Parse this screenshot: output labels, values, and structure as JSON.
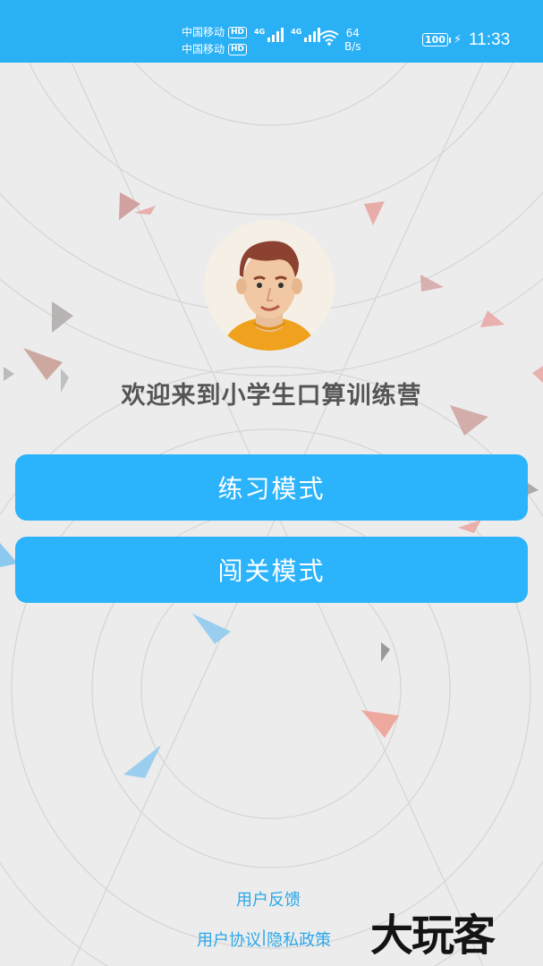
{
  "status_bar": {
    "carrier_1": "中国移动",
    "carrier_2": "中国移动",
    "hd_badge": "HD",
    "network_1": "4G",
    "network_2": "4G",
    "speed_value": "64",
    "speed_unit": "B/s",
    "battery": "100",
    "time": "11:33",
    "background_color": "#29b0f5"
  },
  "main": {
    "welcome_text": "欢迎来到小学生口算训练营",
    "buttons": {
      "practice_label": "练习模式",
      "level_label": "闯关模式"
    },
    "button_color": "#2bb3fb"
  },
  "footer": {
    "feedback": "用户反馈",
    "user_agreement": "用户协议",
    "separator": "|",
    "privacy_policy": "隐私政策",
    "link_color": "#2aa7ea"
  },
  "watermark": "大玩客"
}
